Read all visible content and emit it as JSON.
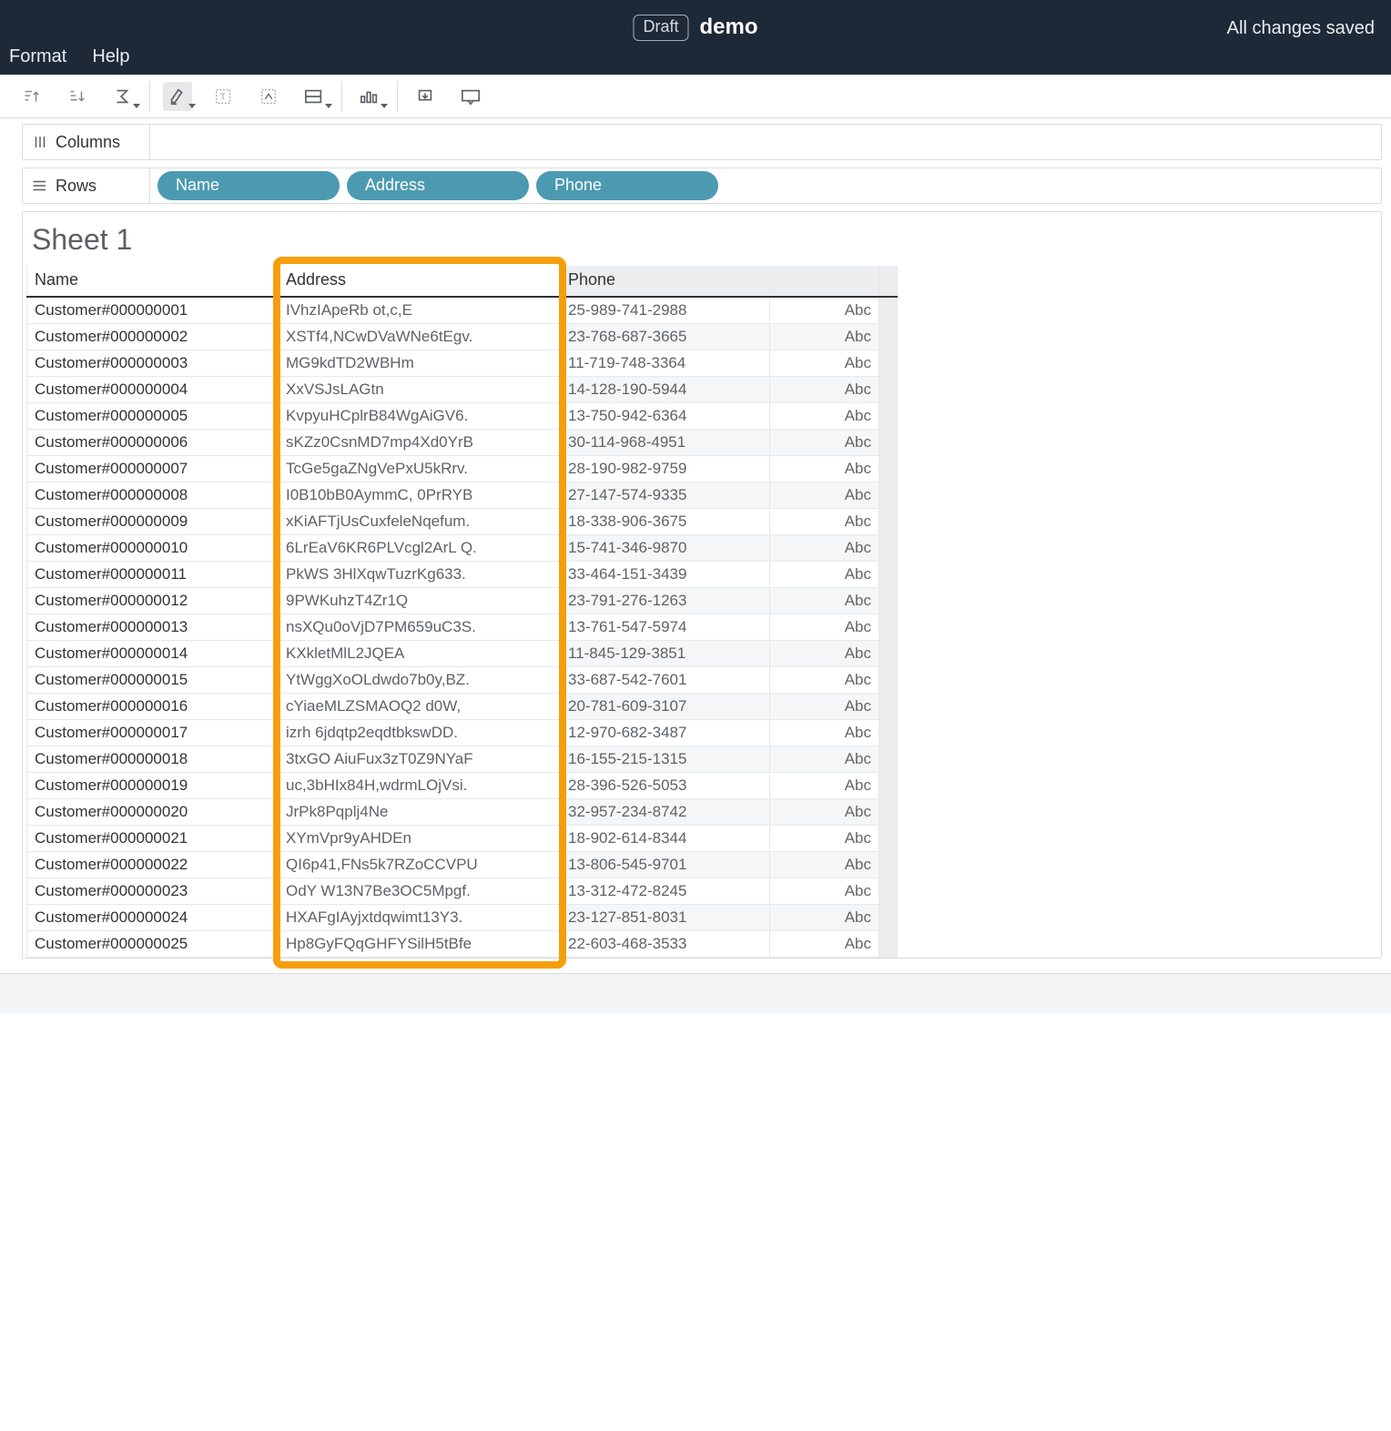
{
  "topbar": {
    "draft_label": "Draft",
    "title": "demo",
    "save_status": "All changes saved",
    "menu_format": "Format",
    "menu_help": "Help"
  },
  "shelves": {
    "columns_label": "Columns",
    "rows_label": "Rows",
    "columns": [],
    "rows": [
      "Name",
      "Address",
      "Phone"
    ]
  },
  "sheet": {
    "title": "Sheet 1",
    "headers": {
      "name": "Name",
      "address": "Address",
      "phone": "Phone"
    },
    "abc_label": "Abc",
    "rows": [
      {
        "name": "Customer#000000001",
        "address": "IVhzIApeRb ot,c,E",
        "phone": "25-989-741-2988"
      },
      {
        "name": "Customer#000000002",
        "address": "XSTf4,NCwDVaWNe6tEgv.",
        "phone": "23-768-687-3665"
      },
      {
        "name": "Customer#000000003",
        "address": "MG9kdTD2WBHm",
        "phone": "11-719-748-3364"
      },
      {
        "name": "Customer#000000004",
        "address": "XxVSJsLAGtn",
        "phone": "14-128-190-5944"
      },
      {
        "name": "Customer#000000005",
        "address": "KvpyuHCplrB84WgAiGV6.",
        "phone": "13-750-942-6364"
      },
      {
        "name": "Customer#000000006",
        "address": "sKZz0CsnMD7mp4Xd0YrB",
        "phone": "30-114-968-4951"
      },
      {
        "name": "Customer#000000007",
        "address": "TcGe5gaZNgVePxU5kRrv.",
        "phone": "28-190-982-9759"
      },
      {
        "name": "Customer#000000008",
        "address": "I0B10bB0AymmC, 0PrRYB",
        "phone": "27-147-574-9335"
      },
      {
        "name": "Customer#000000009",
        "address": "xKiAFTjUsCuxfeleNqefum.",
        "phone": "18-338-906-3675"
      },
      {
        "name": "Customer#000000010",
        "address": "6LrEaV6KR6PLVcgl2ArL Q.",
        "phone": "15-741-346-9870"
      },
      {
        "name": "Customer#000000011",
        "address": "PkWS 3HlXqwTuzrKg633.",
        "phone": "33-464-151-3439"
      },
      {
        "name": "Customer#000000012",
        "address": "9PWKuhzT4Zr1Q",
        "phone": "23-791-276-1263"
      },
      {
        "name": "Customer#000000013",
        "address": "nsXQu0oVjD7PM659uC3S.",
        "phone": "13-761-547-5974"
      },
      {
        "name": "Customer#000000014",
        "address": "KXkletMlL2JQEA",
        "phone": "11-845-129-3851"
      },
      {
        "name": "Customer#000000015",
        "address": "YtWggXoOLdwdo7b0y,BZ.",
        "phone": "33-687-542-7601"
      },
      {
        "name": "Customer#000000016",
        "address": "cYiaeMLZSMAOQ2 d0W,",
        "phone": "20-781-609-3107"
      },
      {
        "name": "Customer#000000017",
        "address": "izrh 6jdqtp2eqdtbkswDD.",
        "phone": "12-970-682-3487"
      },
      {
        "name": "Customer#000000018",
        "address": "3txGO AiuFux3zT0Z9NYaF",
        "phone": "16-155-215-1315"
      },
      {
        "name": "Customer#000000019",
        "address": "uc,3bHIx84H,wdrmLOjVsi.",
        "phone": "28-396-526-5053"
      },
      {
        "name": "Customer#000000020",
        "address": "JrPk8Pqplj4Ne",
        "phone": "32-957-234-8742"
      },
      {
        "name": "Customer#000000021",
        "address": "XYmVpr9yAHDEn",
        "phone": "18-902-614-8344"
      },
      {
        "name": "Customer#000000022",
        "address": "QI6p41,FNs5k7RZoCCVPU",
        "phone": "13-806-545-9701"
      },
      {
        "name": "Customer#000000023",
        "address": "OdY W13N7Be3OC5Mpgf.",
        "phone": "13-312-472-8245"
      },
      {
        "name": "Customer#000000024",
        "address": "HXAFgIAyjxtdqwimt13Y3.",
        "phone": "23-127-851-8031"
      },
      {
        "name": "Customer#000000025",
        "address": "Hp8GyFQqGHFYSilH5tBfe",
        "phone": "22-603-468-3533"
      }
    ]
  }
}
